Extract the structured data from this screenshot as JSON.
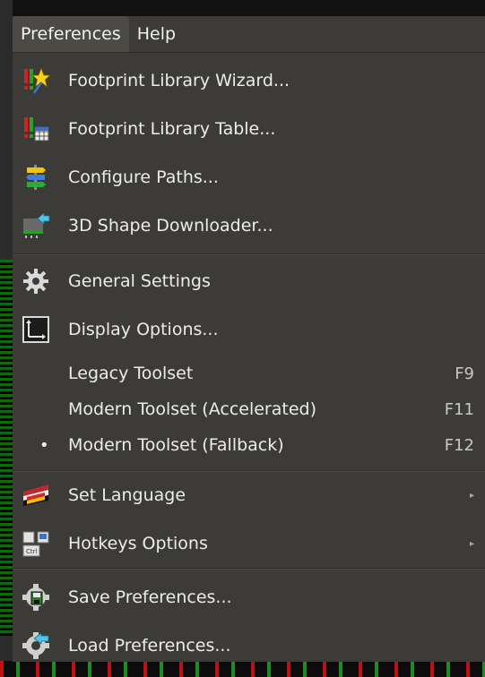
{
  "menubar": {
    "items": [
      {
        "label": "Preferences",
        "active": true
      },
      {
        "label": "Help",
        "active": false
      }
    ]
  },
  "menu": {
    "items": [
      {
        "label": "Footprint Library Wizard...",
        "icon": "library-wizard-icon"
      },
      {
        "label": "Footprint Library Table...",
        "icon": "library-table-icon"
      },
      {
        "label": "Configure Paths...",
        "icon": "signpost-icon"
      },
      {
        "label": "3D Shape Downloader...",
        "icon": "download-3d-icon"
      },
      {
        "label": "General Settings",
        "icon": "gear-icon"
      },
      {
        "label": "Display Options...",
        "icon": "display-options-icon"
      },
      {
        "label": "Legacy Toolset",
        "shortcut": "F9"
      },
      {
        "label": "Modern Toolset (Accelerated)",
        "shortcut": "F11"
      },
      {
        "label": "Modern Toolset (Fallback)",
        "shortcut": "F12",
        "selected": true,
        "bullet": "•"
      },
      {
        "label": "Set Language",
        "icon": "language-flag-icon",
        "submenu": true
      },
      {
        "label": "Hotkeys Options",
        "icon": "keyboard-icon",
        "submenu": true
      },
      {
        "label": "Save Preferences...",
        "icon": "save-settings-icon"
      },
      {
        "label": "Load Preferences...",
        "icon": "load-settings-icon"
      }
    ],
    "submenu_arrow": "▸"
  },
  "colors": {
    "menu_bg": "#3c3b37",
    "text": "#ececec",
    "shortcut": "#c7c7c7"
  }
}
